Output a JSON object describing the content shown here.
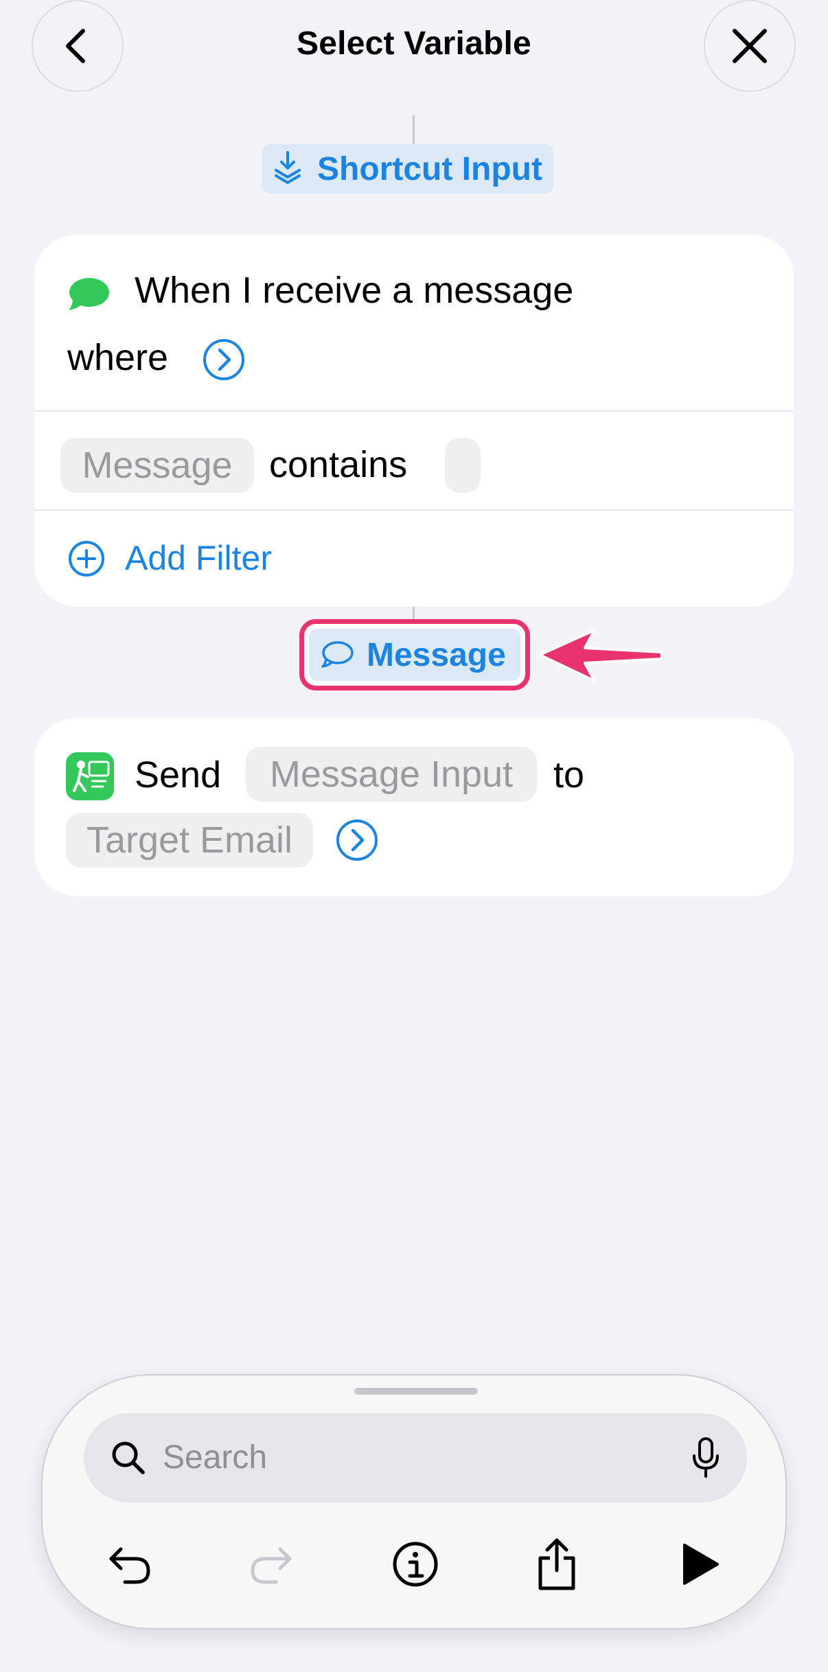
{
  "header": {
    "title": "Select Variable",
    "back_icon": "chevron-left-icon",
    "close_icon": "close-icon"
  },
  "shortcut_input": {
    "label": "Shortcut Input",
    "icon": "stack-download-icon"
  },
  "trigger_card": {
    "icon": "messages-bubble-icon",
    "title": "When I receive a message",
    "where": "where",
    "filter_token": "Message",
    "filter_operator": "contains",
    "filter_value": "",
    "add_filter_label": "Add Filter"
  },
  "message_variable": {
    "label": "Message",
    "icon": "speech-bubble-icon"
  },
  "send_card": {
    "icon": "sms-app-icon",
    "send_label": "Send",
    "message_placeholder": "Message Input",
    "to_label": "to",
    "target_placeholder": "Target Email"
  },
  "toolbar": {
    "search_placeholder": "Search"
  },
  "colors": {
    "accent_blue": "#1c84e0",
    "highlight_pink": "#e8336e",
    "messages_green": "#34c759",
    "background": "#f2f2f7"
  }
}
